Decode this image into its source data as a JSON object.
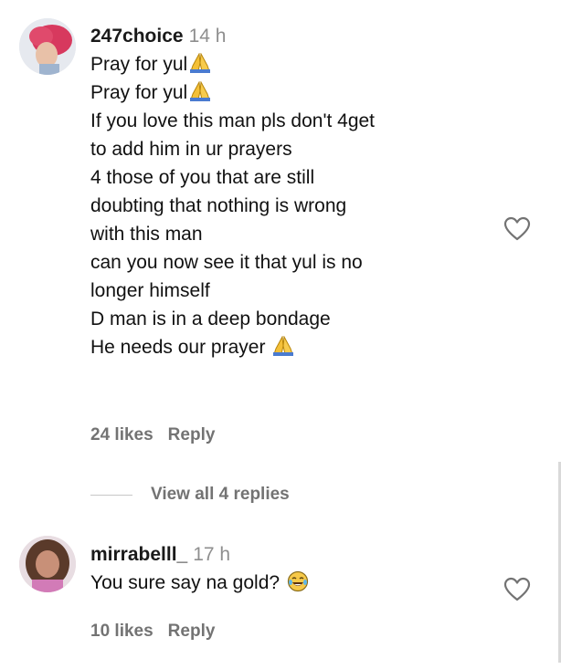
{
  "comments": [
    {
      "username": "247choice",
      "time": "14 h",
      "lines": [
        "Pray for yul",
        "Pray for yul",
        "If you love this man pls don't 4get",
        "to add him in ur prayers",
        "4 those of you that are still",
        "doubting that nothing is wrong",
        "with this man",
        "can you now see it that yul is no",
        "longer himself",
        "D man is in a deep bondage",
        "He needs our prayer "
      ],
      "likes": "24 likes",
      "reply": "Reply",
      "view_replies": "View all 4 replies"
    },
    {
      "username": "mirrabelll_",
      "time": "17 h",
      "lines": [
        "You sure say na gold? "
      ],
      "likes": "10 likes",
      "reply": "Reply"
    }
  ],
  "icons": {
    "emoji_pray": "folded-hands",
    "emoji_laugh": "tears-of-joy",
    "like": "heart-outline"
  },
  "colors": {
    "muted": "#737373",
    "timestamp": "#8e8e8e",
    "pray_emoji": "#f4c038",
    "laugh_emoji": "#f7c948"
  }
}
